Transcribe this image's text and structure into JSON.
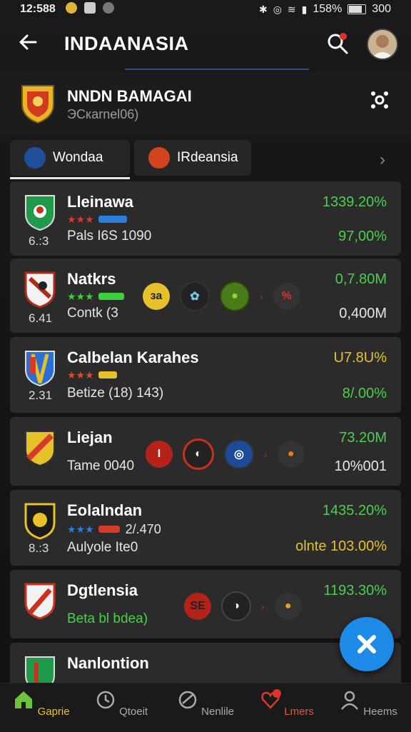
{
  "status_bar": {
    "time": "12:588",
    "battery": "158%",
    "signal_text": "300"
  },
  "header": {
    "title": "INDAANASIA"
  },
  "team": {
    "name": "NNDN BAMAGAI",
    "subtitle": "ЭСкаrnel06)"
  },
  "tabs": [
    {
      "label": "Wondaa",
      "active": true
    },
    {
      "label": "IRdeansia",
      "active": false
    }
  ],
  "rows": [
    {
      "name": "Lleinawa",
      "num": "6.:3",
      "sub": "Pals I6S 1090",
      "val1": "1339.20%",
      "val2": "97,00%",
      "val2_color": "#4ccf4c",
      "stars": "★★★",
      "stars_color": "#d53a2a",
      "bar_color": "#2a7fe0",
      "icons": []
    },
    {
      "name": "Natkrs",
      "num": "6.41",
      "sub": "Contk (3",
      "val1": "0,7.80M",
      "val2": "0,400M",
      "val2_color": "#e6e6e6",
      "stars": "★★★",
      "stars_color": "#3ad13a",
      "bar_color": "#3ad13a",
      "icons": [
        "за",
        "",
        "",
        "%"
      ]
    },
    {
      "name": "Calbelan Karahes",
      "num": "2.31",
      "sub": "Betize (18) 143)",
      "val1": "U7.8U%",
      "val1_color": "#e6c12a",
      "val2": "8/.00%",
      "val2_color": "#4ccf4c",
      "stars": "★★★",
      "stars_color": "#e34a2a",
      "bar_color": "#e6c12a",
      "icons": []
    },
    {
      "name": "Liejan",
      "num": "",
      "sub": "Tame 0040",
      "val1": "73.20M",
      "val2": "10%001",
      "val2_color": "#e6e6e6",
      "stars": "",
      "stars_color": "",
      "bar_color": "",
      "icons": [
        "I",
        "",
        "",
        ""
      ]
    },
    {
      "name": "Eolalndan",
      "num": "8.:3",
      "sub": "Aulyole Ite0",
      "val1": "1435.20%",
      "val2": "olnte 103.00%",
      "val2_color": "#e6c12a",
      "stars": "★★★",
      "stars_color": "#2a7fe0",
      "bar_color": "#d53a2a",
      "extra": "2/.470",
      "icons": []
    },
    {
      "name": "Dgtlensia",
      "num": "",
      "sub": "Beta bl bdea)",
      "sub_color": "#4ccf4c",
      "val1": "1193.30%",
      "val2": "",
      "val2_color": "#e6e6e6",
      "stars": "",
      "stars_color": "",
      "bar_color": "",
      "icons": [
        "SE",
        "",
        ""
      ]
    },
    {
      "name": "Nanlontion",
      "num": "",
      "sub": "",
      "val1": "",
      "val2": "",
      "stars": "",
      "icons": []
    }
  ],
  "nav": [
    {
      "label": "Gaprie",
      "active": true,
      "icon": "home-icon"
    },
    {
      "label": "Qtoeit",
      "active": false,
      "icon": "stats-icon"
    },
    {
      "label": "Nenlile",
      "active": false,
      "icon": "ball-icon"
    },
    {
      "label": "Lmers",
      "active": false,
      "icon": "heart-icon",
      "badge": true
    },
    {
      "label": "Heems",
      "active": false,
      "icon": "user-icon"
    }
  ],
  "colors": {
    "accent_green": "#4ccf4c",
    "accent_blue": "#1e8ae8",
    "accent_red": "#d53a2a",
    "accent_yellow": "#e6c12a"
  }
}
